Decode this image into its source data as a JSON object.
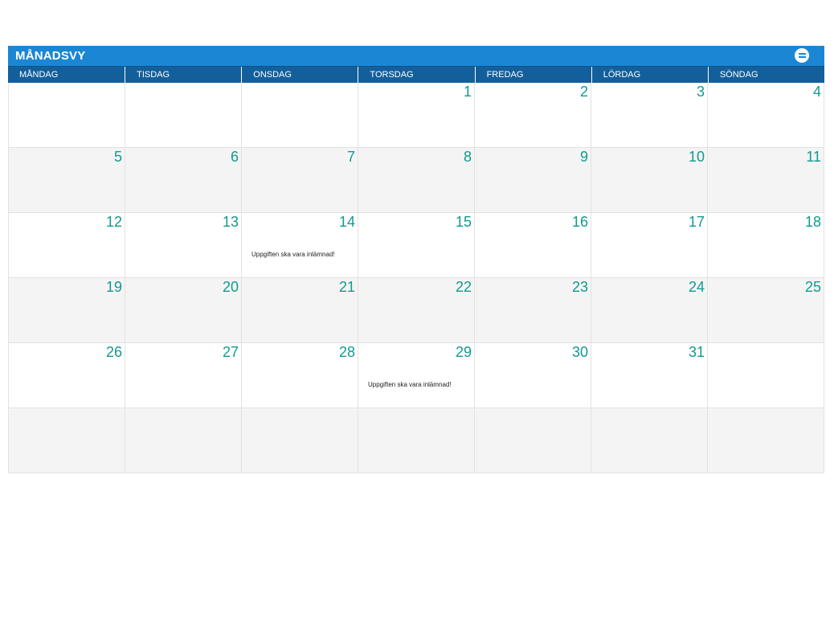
{
  "header": {
    "title": "MÅNADSVY",
    "menu_icon": "menu-icon"
  },
  "weekdays": [
    "MÅNDAG",
    "TISDAG",
    "ONSDAG",
    "TORSDAG",
    "FREDAG",
    "LÖRDAG",
    "SÖNDAG"
  ],
  "weeks": [
    {
      "shaded": false,
      "days": [
        {
          "num": ""
        },
        {
          "num": ""
        },
        {
          "num": ""
        },
        {
          "num": "1"
        },
        {
          "num": "2"
        },
        {
          "num": "3"
        },
        {
          "num": "4"
        }
      ]
    },
    {
      "shaded": true,
      "days": [
        {
          "num": "5"
        },
        {
          "num": "6"
        },
        {
          "num": "7"
        },
        {
          "num": "8"
        },
        {
          "num": "9"
        },
        {
          "num": "10"
        },
        {
          "num": "11"
        }
      ]
    },
    {
      "shaded": false,
      "days": [
        {
          "num": "12"
        },
        {
          "num": "13"
        },
        {
          "num": "14",
          "note": "Uppgiften ska vara inlämnad!"
        },
        {
          "num": "15"
        },
        {
          "num": "16"
        },
        {
          "num": "17"
        },
        {
          "num": "18"
        }
      ]
    },
    {
      "shaded": true,
      "days": [
        {
          "num": "19"
        },
        {
          "num": "20"
        },
        {
          "num": "21"
        },
        {
          "num": "22"
        },
        {
          "num": "23"
        },
        {
          "num": "24"
        },
        {
          "num": "25"
        }
      ]
    },
    {
      "shaded": false,
      "days": [
        {
          "num": "26"
        },
        {
          "num": "27"
        },
        {
          "num": "28"
        },
        {
          "num": "29",
          "note": "Uppgiften ska vara inlämnad!"
        },
        {
          "num": "30"
        },
        {
          "num": "31"
        },
        {
          "num": ""
        }
      ]
    },
    {
      "shaded": true,
      "days": [
        {
          "num": ""
        },
        {
          "num": ""
        },
        {
          "num": ""
        },
        {
          "num": ""
        },
        {
          "num": ""
        },
        {
          "num": ""
        },
        {
          "num": ""
        }
      ]
    }
  ],
  "colors": {
    "title_bar": "#1b86d4",
    "weekday_bar": "#135f9b",
    "day_number": "#109a8f",
    "shaded_row": "#f4f4f4"
  }
}
